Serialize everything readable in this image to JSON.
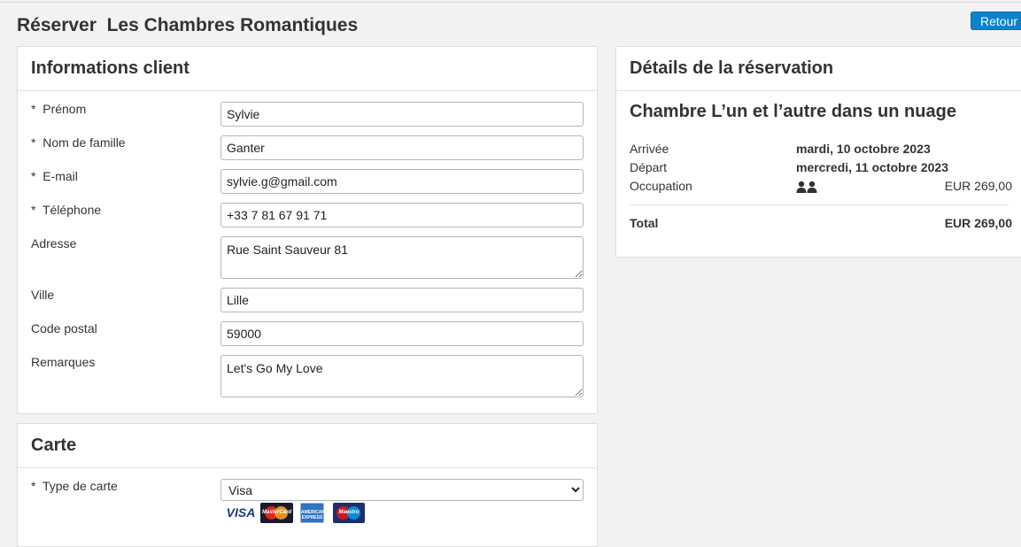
{
  "page": {
    "title": "Réserver  Les Chambres Romantiques",
    "back_label": "Retour"
  },
  "client": {
    "heading": "Informations client",
    "fields": {
      "prenom": {
        "label": "*  Prénom",
        "value": "Sylvie"
      },
      "nom": {
        "label": "*  Nom de famille",
        "value": "Ganter"
      },
      "email": {
        "label": "*  E-mail",
        "value": "sylvie.g@gmail.com"
      },
      "telephone": {
        "label": "*  Téléphone",
        "value": "+33 7 81 67 91 71"
      },
      "adresse": {
        "label": "Adresse",
        "value": "Rue Saint Sauveur 81"
      },
      "ville": {
        "label": "Ville",
        "value": "Lille"
      },
      "code_postal": {
        "label": "Code postal",
        "value": "59000"
      },
      "remarques": {
        "label": "Remarques",
        "value": "Let's Go My Love"
      }
    }
  },
  "carte": {
    "heading": "Carte",
    "type_label": "*  Type de carte",
    "type_selected": "Visa",
    "logos": {
      "visa": "VISA",
      "mastercard": "MasterCard",
      "amex": "AMERICAN EXPRESS",
      "maestro": "Maestro"
    }
  },
  "details": {
    "heading": "Détails de la réservation",
    "room": "Chambre L’un et l’autre dans un nuage",
    "arrivee_label": "Arrivée",
    "arrivee_value": "mardi, 10 octobre 2023",
    "depart_label": "Départ",
    "depart_value": "mercredi, 11 octobre 2023",
    "occupation_label": "Occupation",
    "occupation_icon": "two-people-icon",
    "occupation_price": "EUR 269,00",
    "total_label": "Total",
    "total_value": "EUR 269,00"
  },
  "colors": {
    "accent": "#0a83cc",
    "panel_bg": "#ffffff",
    "page_bg": "#f2f2f2"
  }
}
